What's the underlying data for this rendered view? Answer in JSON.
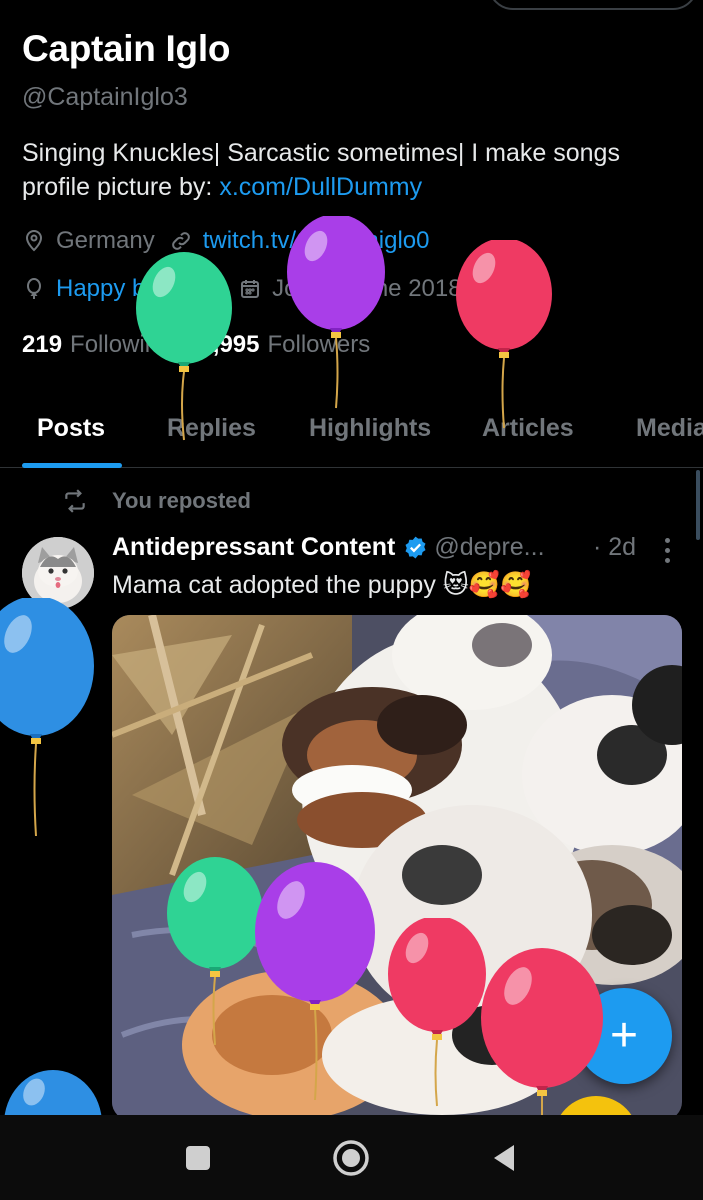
{
  "profile": {
    "name": "Captain Iglo",
    "handle": "@CaptainIglo3",
    "bio_line1": "Singing Knuckles| Sarcastic sometimes| I make songs",
    "bio_line2_prefix": "profile picture by: ",
    "bio_link": "x.com/DullDummy",
    "location": "Germany",
    "website": "twitch.tv/Captainiglo0",
    "birthday": "Happy birthday!",
    "joined": "Joined June 2018",
    "following_count": "219",
    "following_label": "Following",
    "followers_count": "7,995",
    "followers_label": "Followers"
  },
  "tabs": [
    {
      "label": "Posts",
      "active": true
    },
    {
      "label": "Replies"
    },
    {
      "label": "Highlights"
    },
    {
      "label": "Articles"
    },
    {
      "label": "Media"
    }
  ],
  "post": {
    "repost_label": "You reposted",
    "author": "Antidepressant Content",
    "author_handle": "@depre...",
    "time": "· 2d",
    "text": "Mama cat adopted the puppy 😻🥰🥰"
  },
  "fab_label": "+",
  "icons": {
    "location": "location-pin-icon",
    "link": "link-icon",
    "birthday": "balloon-icon",
    "calendar": "calendar-icon",
    "repost": "repost-icon",
    "verified": "verified-badge-icon",
    "more": "more-vertical-icon",
    "compose": "plus-icon",
    "nav": [
      "recents-square-icon",
      "home-circle-icon",
      "back-triangle-icon"
    ]
  },
  "colors": {
    "accent": "#1d9bf0",
    "muted": "#71767b",
    "background": "#000000",
    "balloon_green": "#2fd394",
    "balloon_purple": "#a93ee8",
    "balloon_red": "#ef3a63",
    "balloon_blue": "#2e8fe3"
  }
}
